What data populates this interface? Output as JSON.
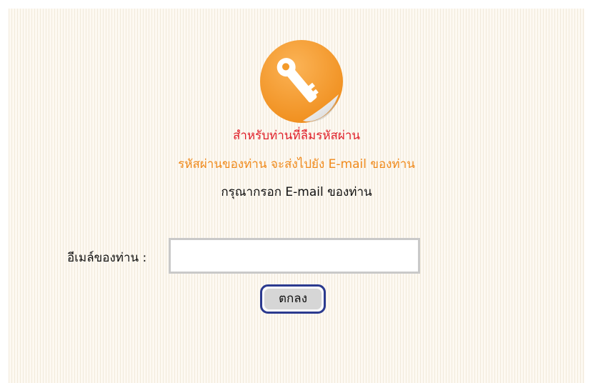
{
  "header": {
    "icon": "key-icon",
    "title_forgot": "สำหรับท่านที่ลืมรหัสผ่าน",
    "title_sent": "รหัสผ่านของท่าน จะส่งไปยัง E-mail ของท่าน",
    "title_enter": "กรุณากรอก E-mail ของท่าน"
  },
  "form": {
    "email_label": "อีเมล์ของท่าน :",
    "email_value": "",
    "submit_label": "ตกลง"
  },
  "colors": {
    "title_forgot": "#e0202a",
    "title_sent": "#f08a1c",
    "icon_orange": "#f7941d",
    "button_border": "#2b3a8f"
  }
}
